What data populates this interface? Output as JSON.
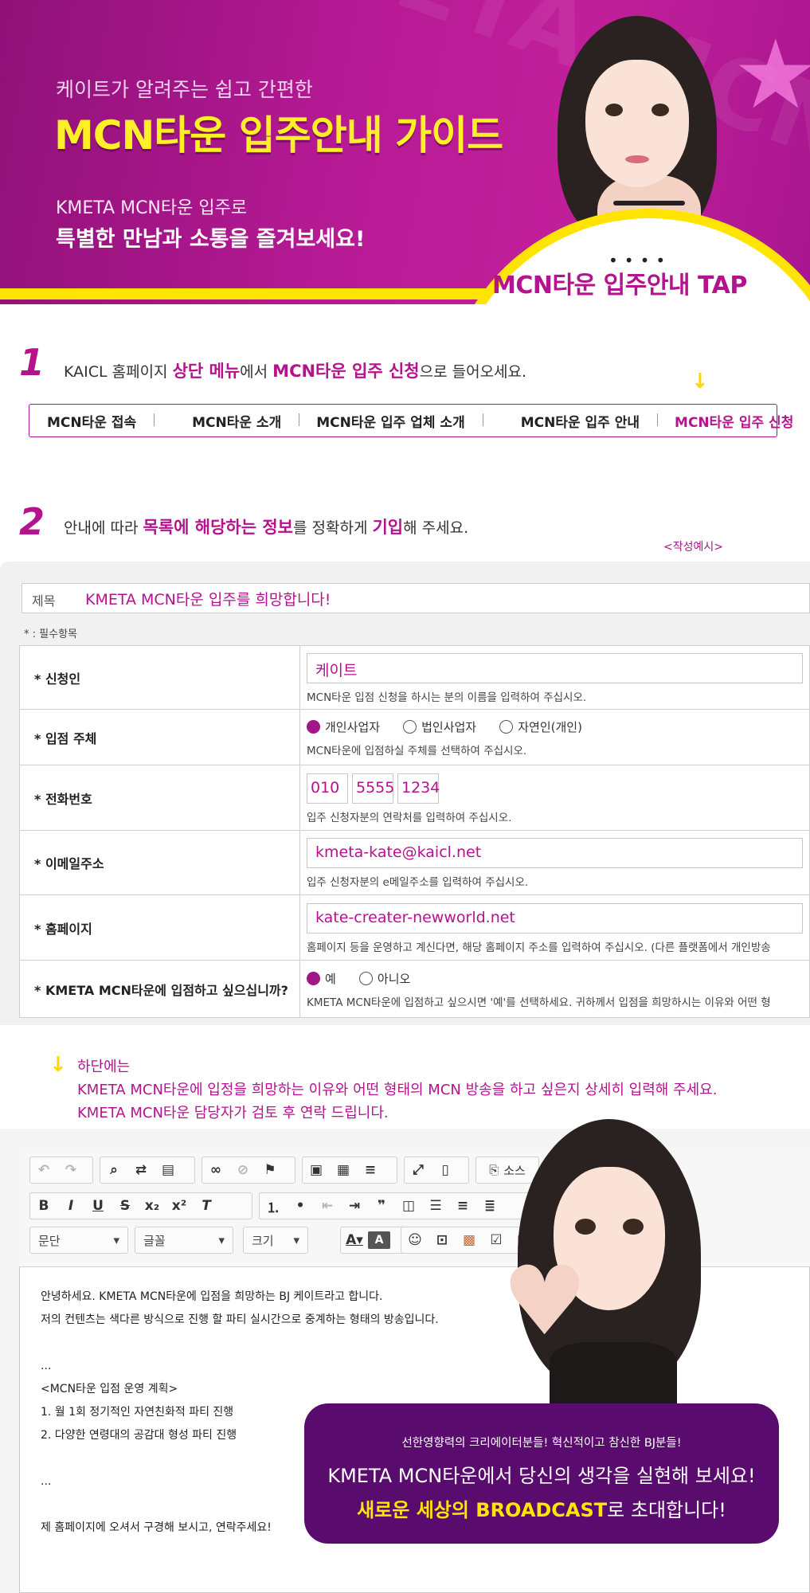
{
  "hero": {
    "subtitle": "케이트가 알려주는 쉽고 간편한",
    "title": "MCN타운 입주안내 가이드",
    "line1": "KMETA MCN타운 입주로",
    "line2": "특별한 만남과 소통을 즐겨보세요!",
    "tap_label": "MCN타운 입주안내 TAP",
    "watermark": "KMETA MCN",
    "colors": {
      "magenta": "#b4138d",
      "yellow": "#ffe400"
    }
  },
  "step1": {
    "number": "1",
    "text_a": "KAICL 홈페이지 ",
    "text_b": "상단 메뉴",
    "text_c": "에서 ",
    "text_d": "MCN타운 입주 신청",
    "text_e": "으로 들어오세요.",
    "arrow": "↓",
    "menu": [
      "MCN타운 접속",
      "MCN타운 소개",
      "MCN타운 입주 업체 소개",
      "MCN타운 입주 안내",
      "MCN타운 입주 신청"
    ]
  },
  "step2": {
    "number": "2",
    "text_a": "안내에 따라 ",
    "text_b": "목록에 해당하는 정보",
    "text_c": "를 정확하게 ",
    "text_d": "기입",
    "text_e": "해 주세요.",
    "example_label": "<작성예시>"
  },
  "form": {
    "subject_label": "제목",
    "subject_value": "KMETA MCN타운 입주를 희망합니다!",
    "required_note": "* : 필수항목",
    "applicant": {
      "label": "* 신청인",
      "value": "케이트",
      "help": "MCN타운 입점 신청을 하시는 분의 이름을 입력하여 주십시오."
    },
    "entity": {
      "label": "* 입점 주체",
      "options": [
        "개인사업자",
        "법인사업자",
        "자연인(개인)"
      ],
      "selected": "개인사업자",
      "help": "MCN타운에 입점하실 주체를 선택하여 주십시오."
    },
    "phone": {
      "label": "* 전화번호",
      "parts": [
        "010",
        "5555",
        "1234"
      ],
      "help": "입주 신청자분의 연락처를 입력하여 주십시오."
    },
    "email": {
      "label": "* 이메일주소",
      "value": "kmeta-kate@kaicl.net",
      "help": "입주 신청자분의 e메일주소를 입력하여 주십시오."
    },
    "homepage": {
      "label": "* 홈페이지",
      "value": "kate-creater-newworld.net",
      "help": "홈페이지 등을 운영하고 계신다면, 해당 홈페이지 주소를 입력하여 주십시오. (다른 플랫폼에서 개인방송"
    },
    "wish": {
      "label": "* KMETA MCN타운에 입점하고 싶으십니까?",
      "options": [
        "예",
        "아니오"
      ],
      "selected": "예",
      "help": "KMETA MCN타운에 입점하고 싶으시면 '예'를 선택하세요. 귀하께서 입점을 희망하시는 이유와 어떤 형"
    }
  },
  "note": {
    "arrow": "↓",
    "line1": "하단에는",
    "line2": "KMETA MCN타운에 입정을 희망하는 이유와 어떤 형태의 MCN 방송을 하고 싶은지 상세히 입력해 주세요.",
    "line3": "KMETA MCN타운 담당자가 검토 후 연락 드립니다."
  },
  "editor": {
    "source_label": "소스",
    "select_paragraph": "문단",
    "select_font": "글꼴",
    "select_size": "크기",
    "body": [
      "안녕하세요. KMETA MCN타운에 입점을 희망하는 BJ 케이트라고 합니다.",
      "저의 컨텐츠는 색다른 방식으로 진행 할 파티 실시간으로 중계하는 형태의 방송입니다.",
      "",
      "...",
      "<MCN타운 입점 운영 계획>",
      "1. 월 1회 정기적인 자연친화적 파티 진행",
      "2. 다양한 연령대의 공감대 형성 파티 진행",
      "",
      "...",
      "",
      "제 홈페이지에 오셔서 구경해 보시고, 연락주세요!"
    ]
  },
  "promo": {
    "line1": "선한영향력의 크리에이터분들! 혁신적이고 참신한 BJ분들!",
    "line2": "KMETA MCN타운에서 당신의 생각을 실현해 보세요!",
    "line3_highlight": "새로운 세상의 BROADCAST",
    "line3_rest": "로 초대합니다!"
  }
}
